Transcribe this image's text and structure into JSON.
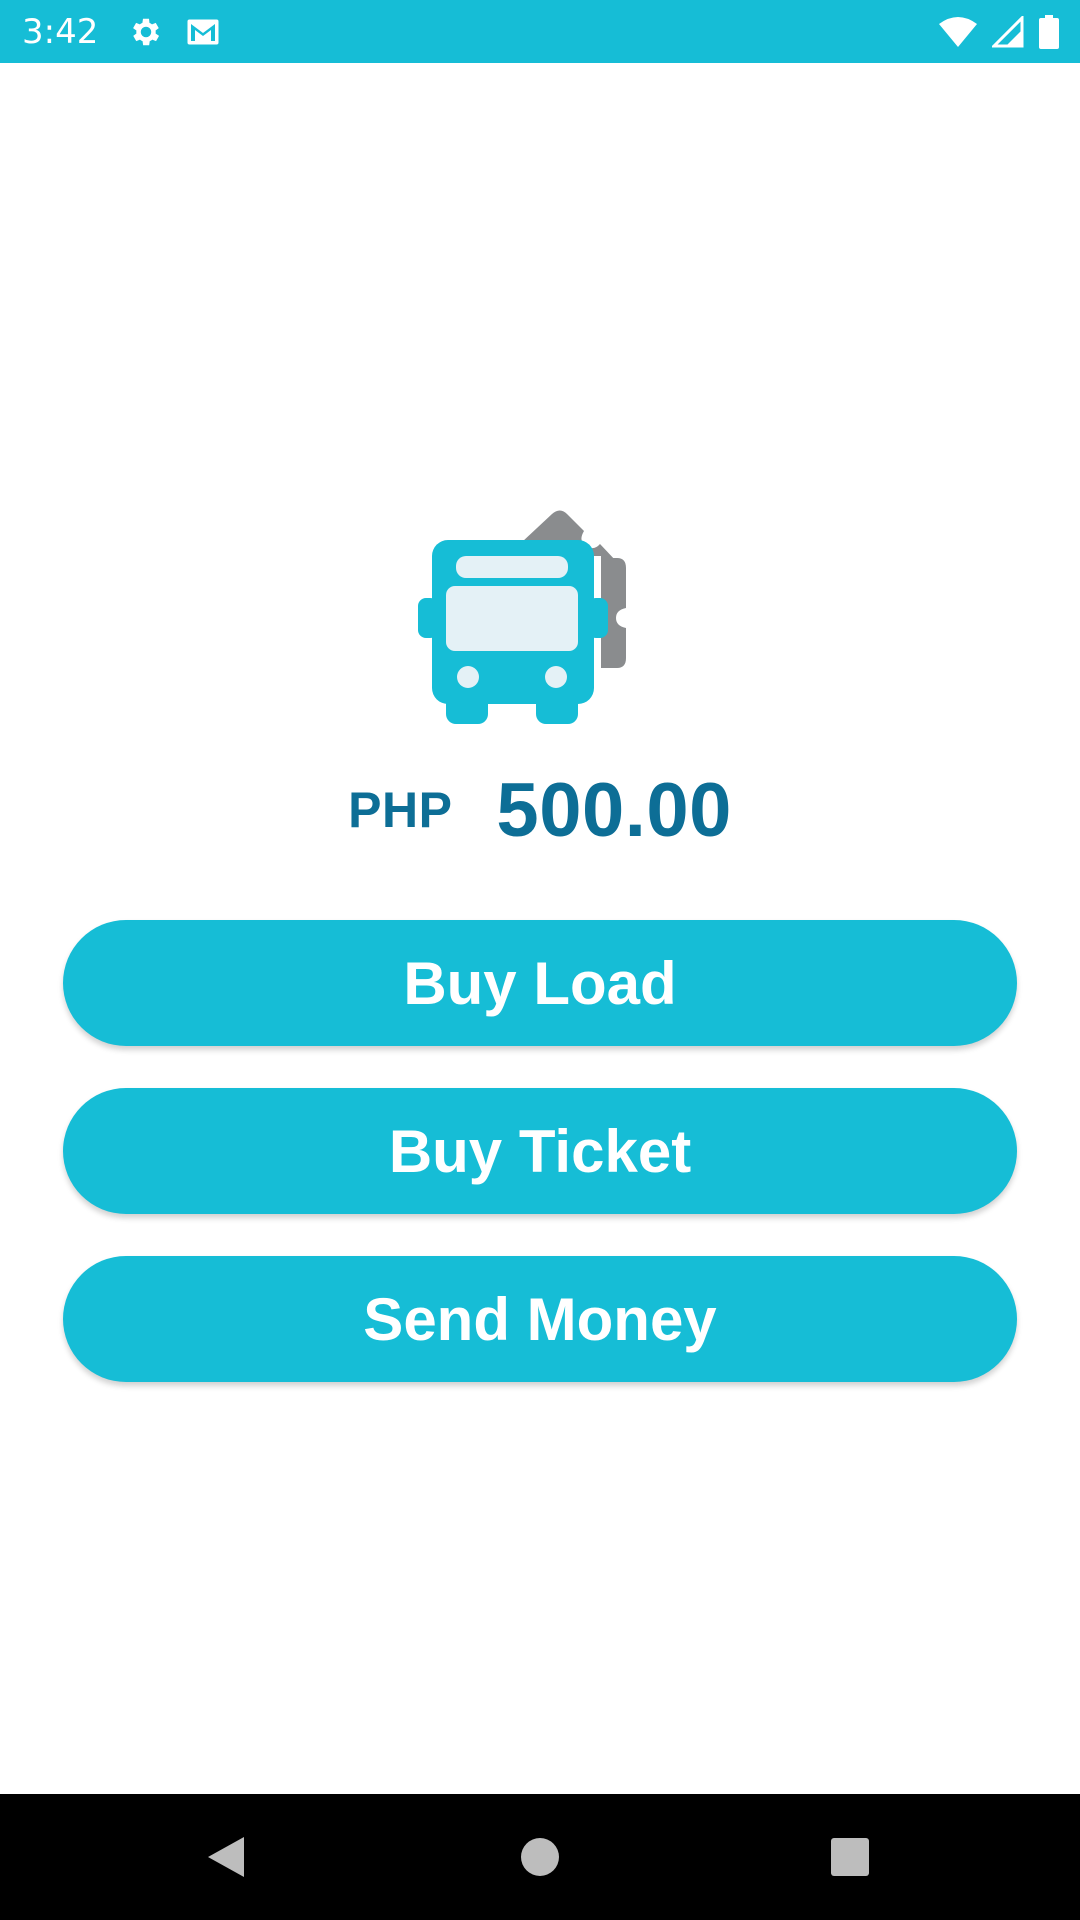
{
  "status_bar": {
    "time": "3:42",
    "left_icons": [
      "gear-icon",
      "gmail-icon"
    ],
    "right_icons": [
      "wifi-icon",
      "signal-icon",
      "battery-icon"
    ],
    "color": "#16bdd6"
  },
  "hero": {
    "icon": "bus-ticket-icon",
    "bus_color": "#16bdd6",
    "ticket_color": "#8a8c8e"
  },
  "balance": {
    "currency": "PHP",
    "amount": "500.00",
    "color": "#0d6e96"
  },
  "actions": {
    "buy_load": "Buy Load",
    "buy_ticket": "Buy Ticket",
    "send_money": "Send Money",
    "color": "#16bdd6"
  },
  "nav_bar": {
    "icons": [
      "back-icon",
      "home-icon",
      "recents-icon"
    ]
  }
}
